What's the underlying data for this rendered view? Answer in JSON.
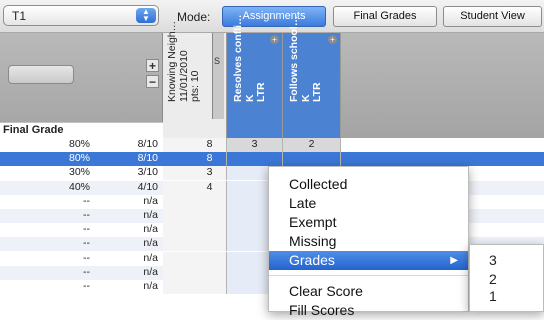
{
  "toolbar": {
    "term_value": "T1",
    "mode_label": "Mode:",
    "modes": [
      "Assignments",
      "Final Grades",
      "Student View"
    ],
    "active_mode": "Assignments"
  },
  "header": {
    "final_grade_label": "Final Grade",
    "plus": "+",
    "minus": "−",
    "slider_label": "S",
    "columns": [
      {
        "line1": "Knowing Neigh…",
        "line2": "11/01/2010",
        "line3": "pts: 10"
      },
      {
        "line1": "Resolves confli…",
        "line2": "K",
        "line3": "LTR"
      },
      {
        "line1": "Follows school…",
        "line2": "K",
        "line3": "LTR"
      }
    ]
  },
  "rows": [
    {
      "pct": "80%",
      "frac": "8/10",
      "v1": "8",
      "v2": "3",
      "v3": "2",
      "selected": false
    },
    {
      "pct": "80%",
      "frac": "8/10",
      "v1": "8",
      "v2": "",
      "v3": "",
      "selected": true
    },
    {
      "pct": "30%",
      "frac": "3/10",
      "v1": "3",
      "v2": "",
      "v3": "",
      "selected": false
    },
    {
      "pct": "40%",
      "frac": "4/10",
      "v1": "4",
      "v2": "",
      "v3": "",
      "selected": false
    },
    {
      "pct": "--",
      "frac": "n/a",
      "v1": "",
      "v2": "",
      "v3": "",
      "selected": false
    },
    {
      "pct": "--",
      "frac": "n/a",
      "v1": "",
      "v2": "",
      "v3": "",
      "selected": false
    },
    {
      "pct": "--",
      "frac": "n/a",
      "v1": "",
      "v2": "",
      "v3": "",
      "selected": false
    },
    {
      "pct": "--",
      "frac": "n/a",
      "v1": "",
      "v2": "",
      "v3": "",
      "selected": false
    },
    {
      "pct": "--",
      "frac": "n/a",
      "v1": "",
      "v2": "",
      "v3": "",
      "selected": false
    },
    {
      "pct": "--",
      "frac": "n/a",
      "v1": "",
      "v2": "",
      "v3": "",
      "selected": false
    },
    {
      "pct": "--",
      "frac": "n/a",
      "v1": "",
      "v2": "",
      "v3": "",
      "selected": false
    }
  ],
  "context_menu": {
    "items": [
      "Collected",
      "Late",
      "Exempt",
      "Missing",
      "Grades",
      "Clear Score",
      "Fill Scores"
    ],
    "highlighted": "Grades",
    "submenu_arrow": "▶"
  },
  "submenu": {
    "items": [
      "3",
      "2",
      "1"
    ]
  },
  "colors": {
    "accent": "#3a7bdc",
    "selected_row": "#3b77d6",
    "header_gray": "#b2b2b2"
  }
}
